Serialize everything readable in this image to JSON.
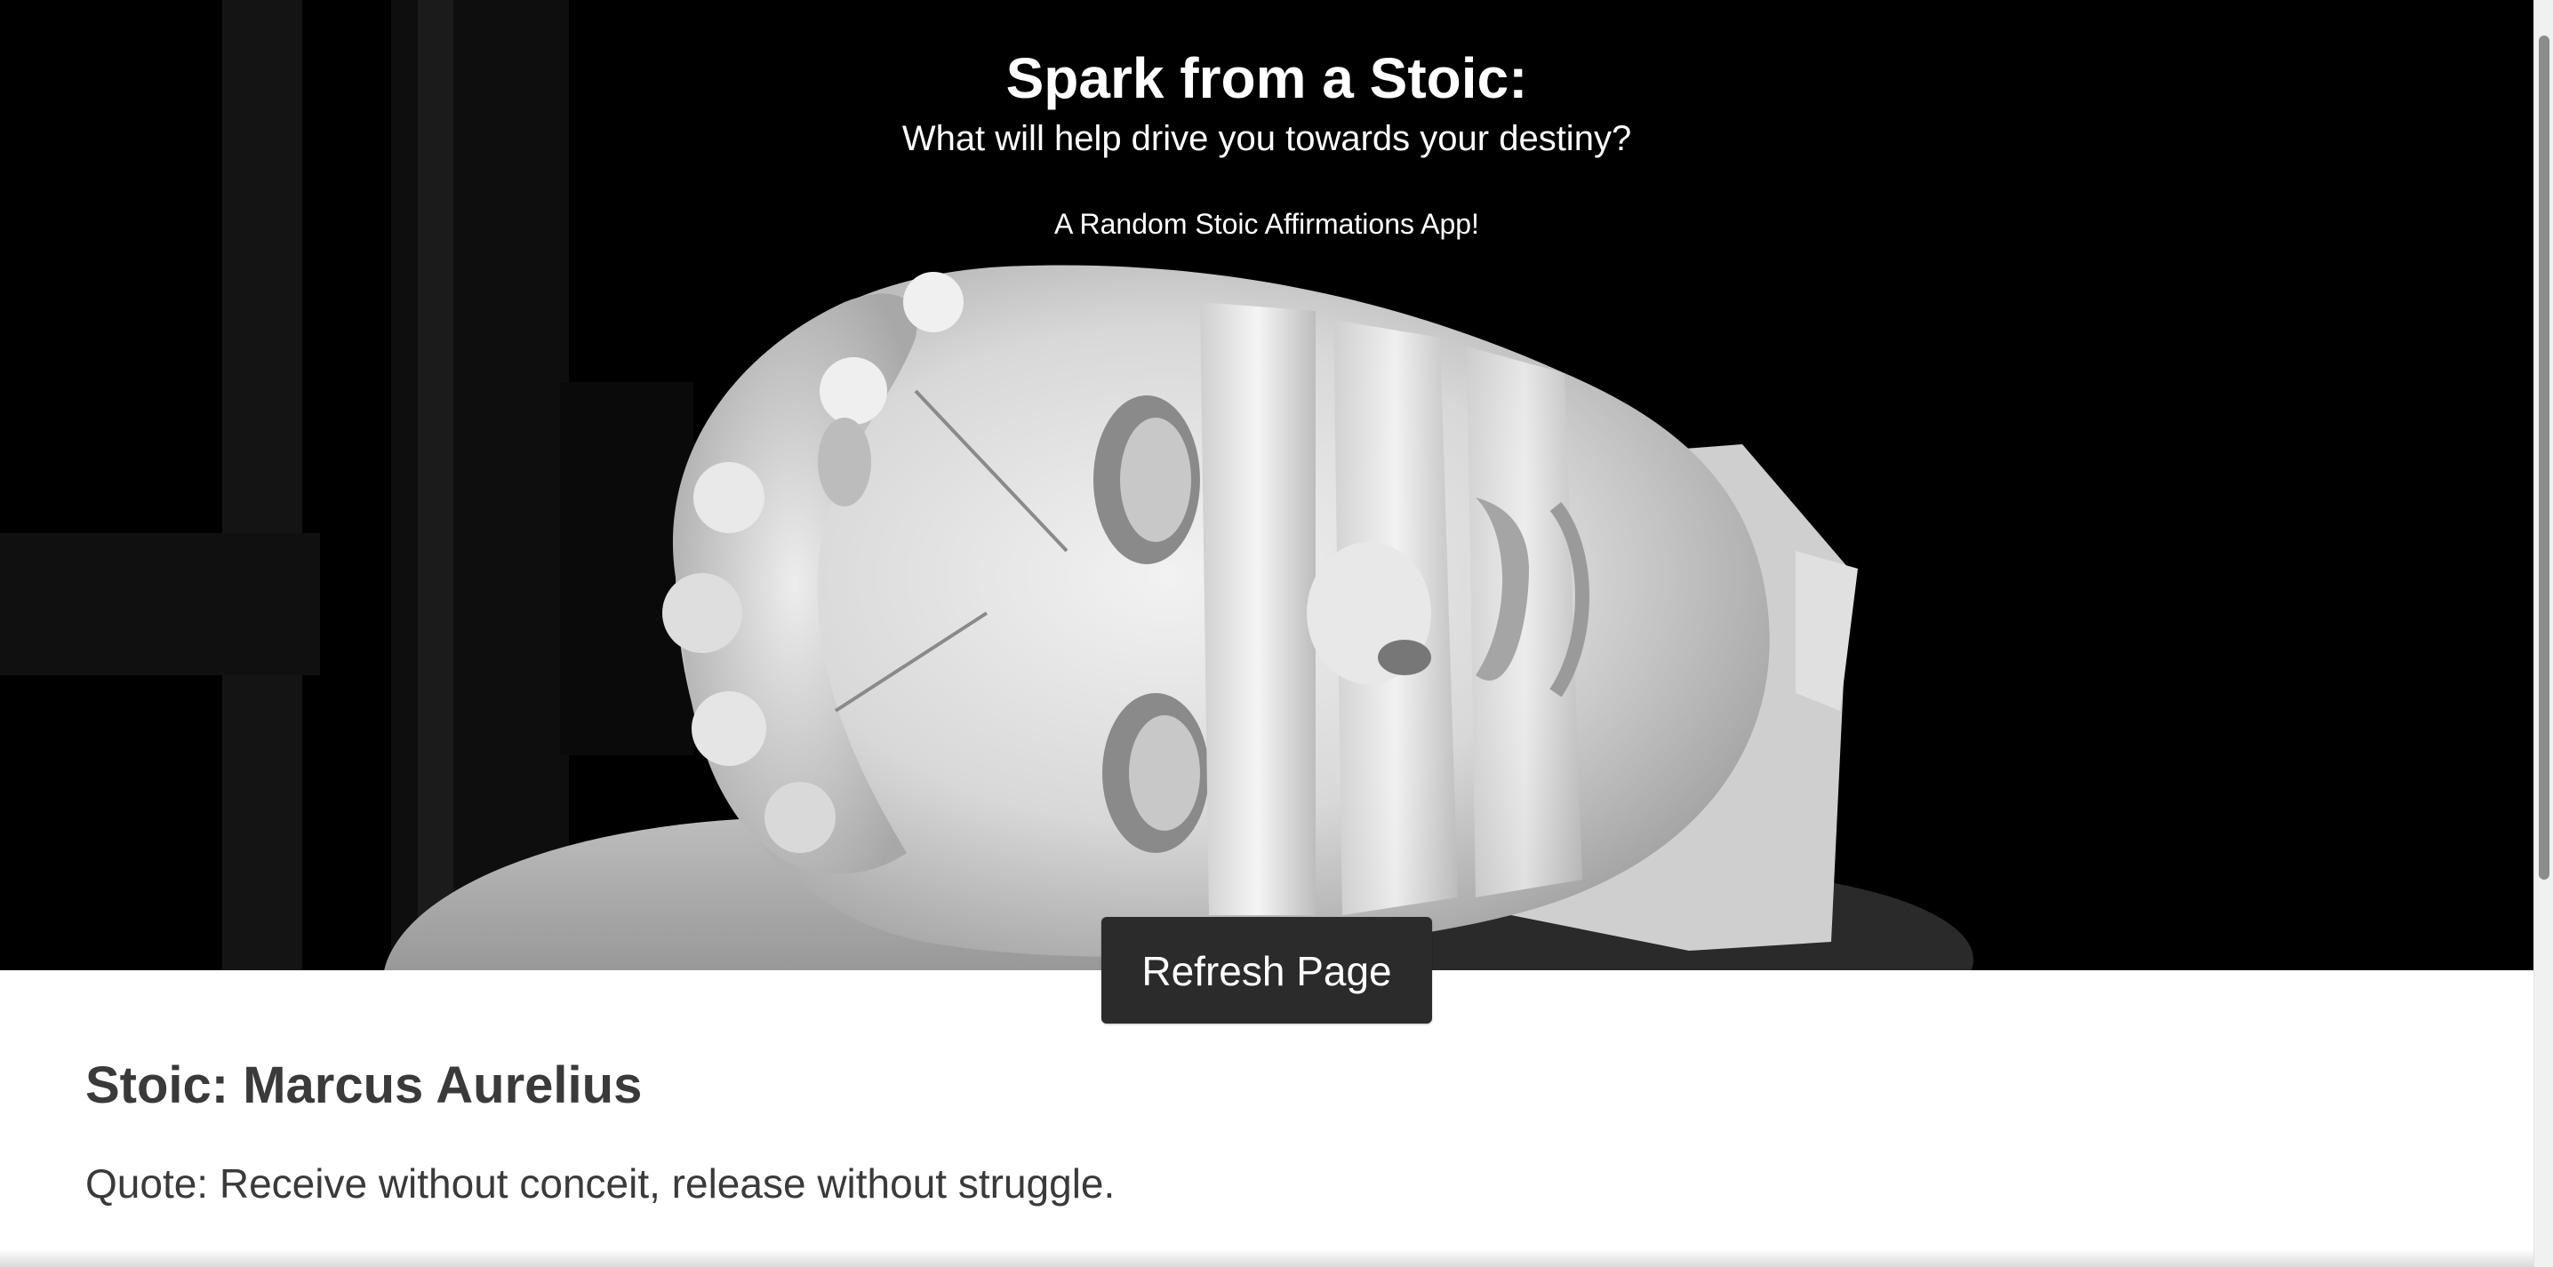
{
  "hero": {
    "title": "Spark from a Stoic:",
    "subtitle": "What will help drive you towards your destiny?",
    "tagline": "A Random Stoic Affirmations App!",
    "image": "marble-statue-head-bandaged"
  },
  "actions": {
    "refresh_label": "Refresh Page"
  },
  "content": {
    "stoic_line": "Stoic: Marcus Aurelius",
    "quote_line": "Quote: Receive without conceit, release without struggle."
  },
  "colors": {
    "hero_background": "#000000",
    "button_background": "#2b2b2b",
    "text": "#3a3a3a"
  }
}
